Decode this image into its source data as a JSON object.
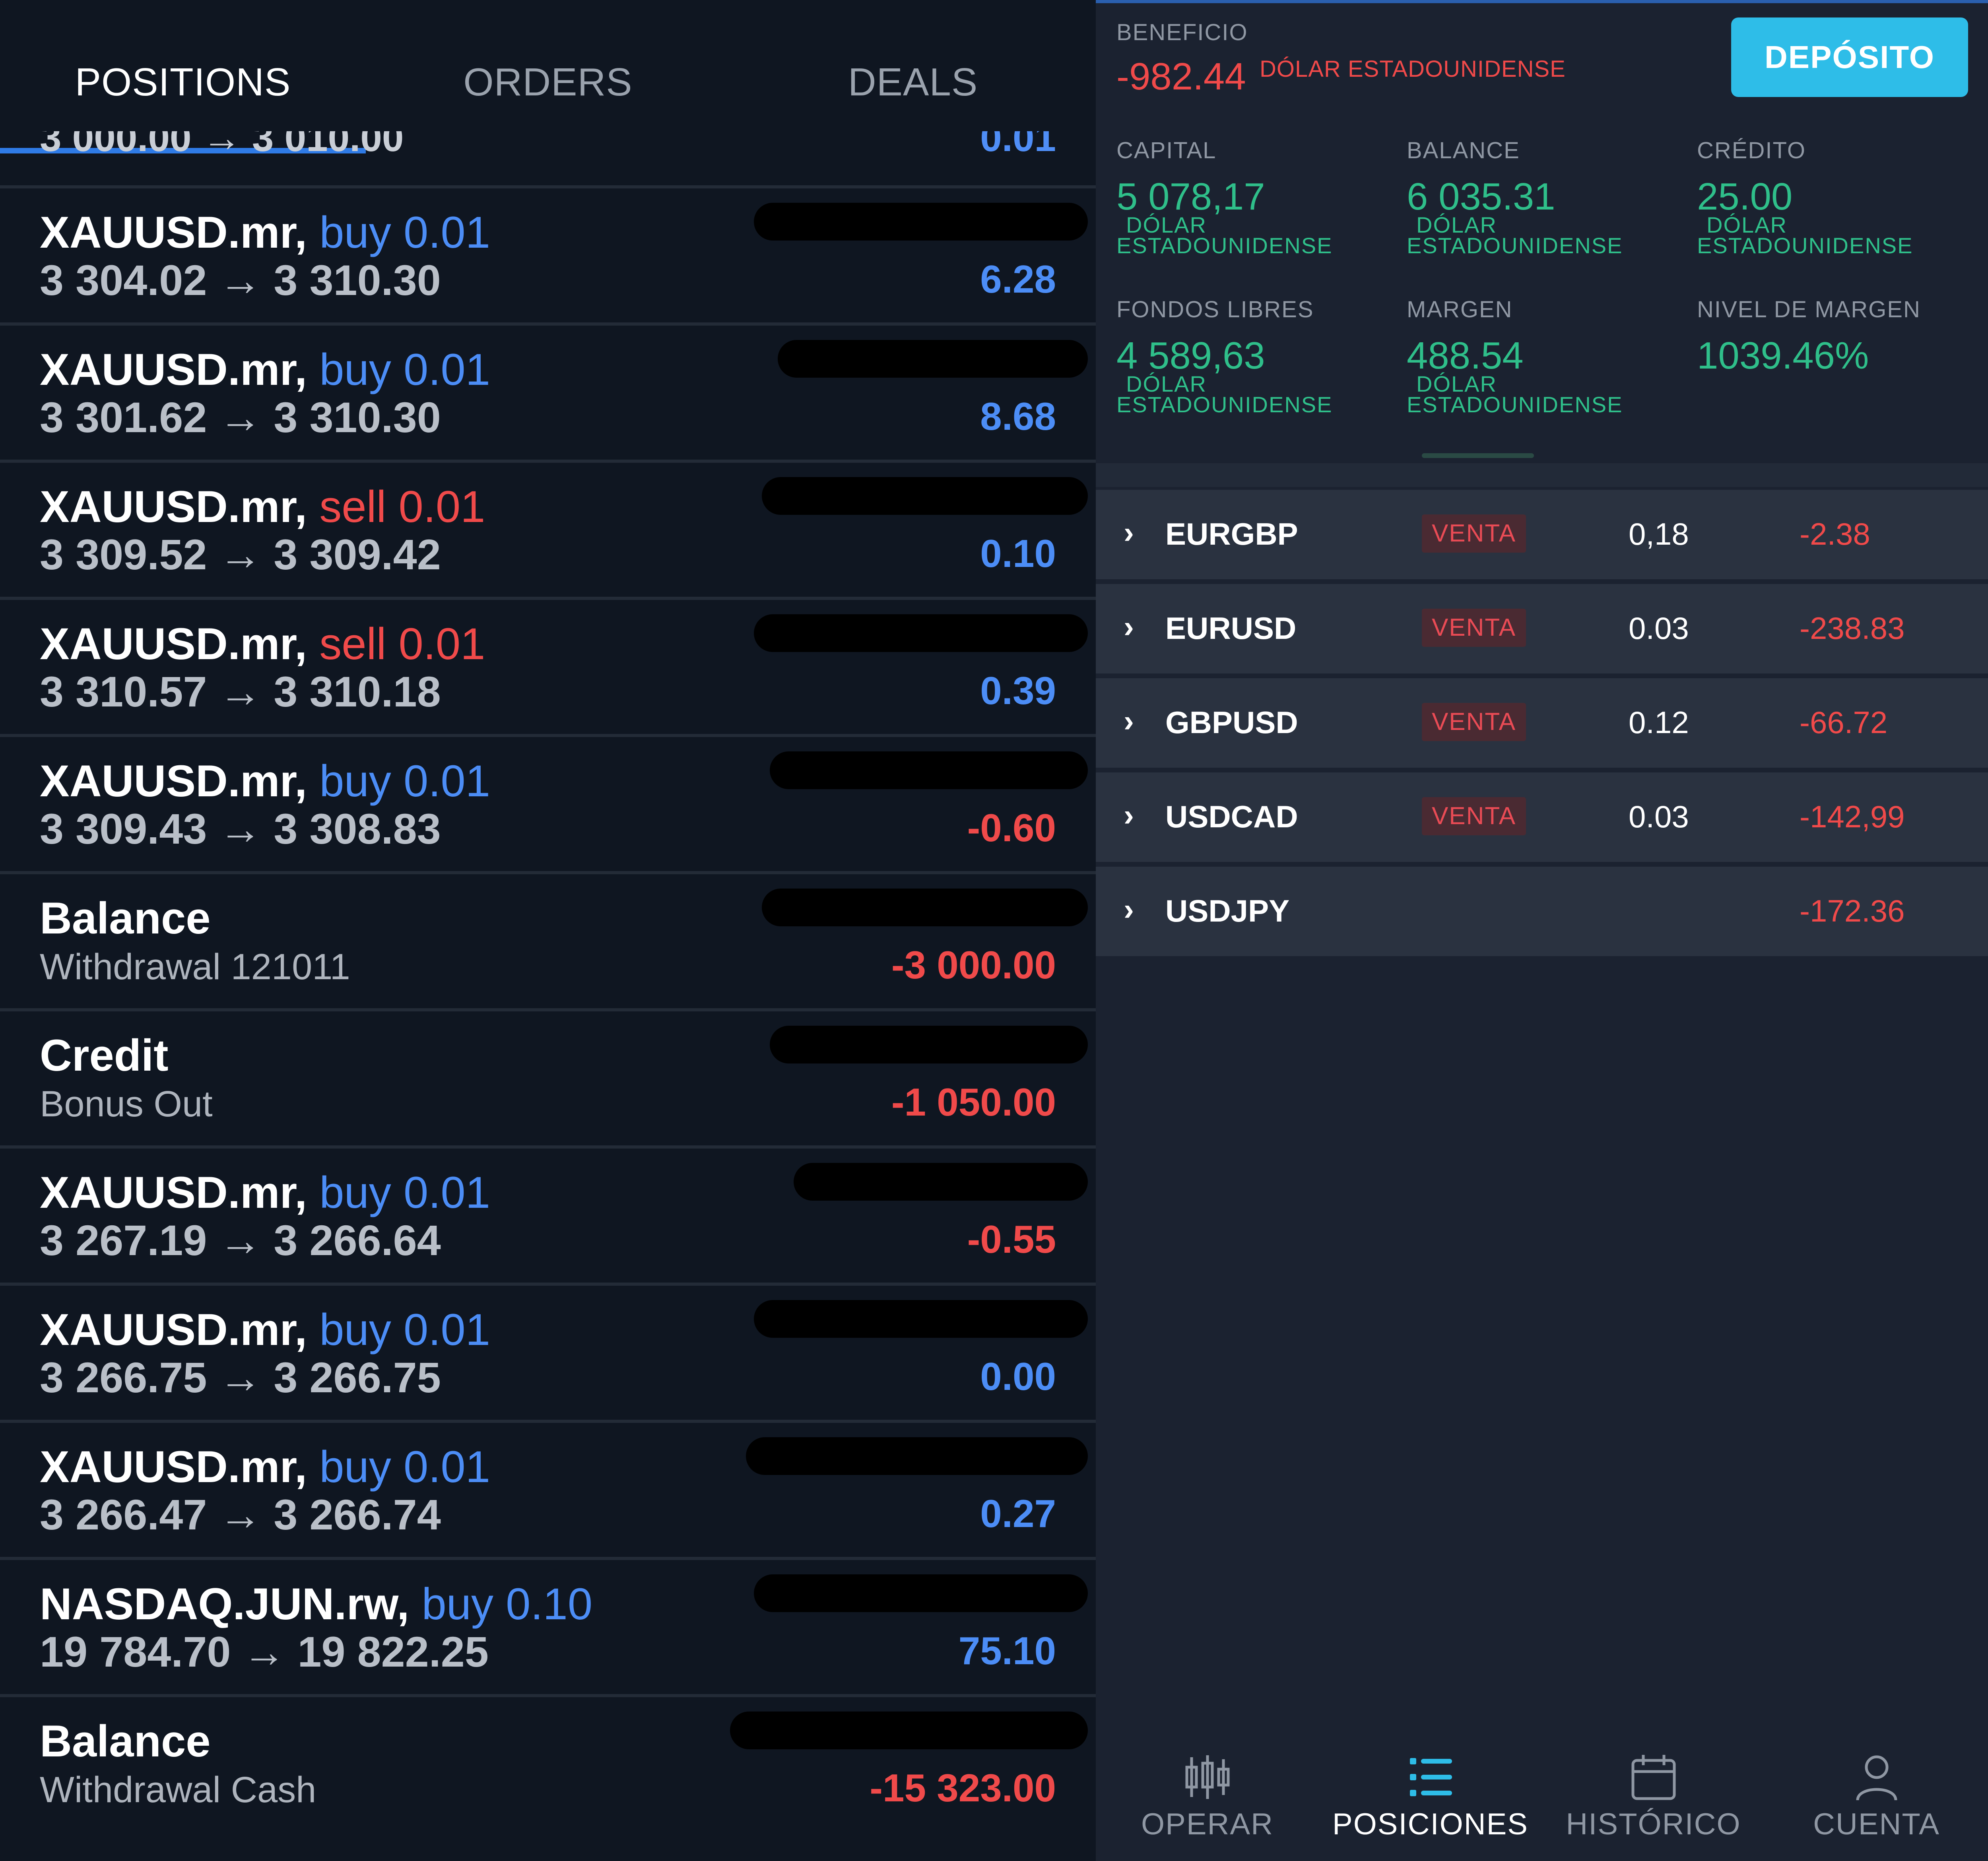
{
  "left": {
    "tabs": [
      {
        "label": "POSITIONS",
        "active": true
      },
      {
        "label": "ORDERS",
        "active": false
      },
      {
        "label": "DEALS",
        "active": false
      }
    ],
    "deals": [
      {
        "title": "XAUUSD.mr,",
        "side": "buy",
        "side_label": "buy 0.01",
        "prices": "3 304.02 → 3 310.30",
        "profit": "6.28",
        "sign": "pos"
      },
      {
        "title": "XAUUSD.mr,",
        "side": "buy",
        "side_label": "buy 0.01",
        "prices": "3 301.62 → 3 310.30",
        "profit": "8.68",
        "sign": "pos"
      },
      {
        "title": "XAUUSD.mr,",
        "side": "sell",
        "side_label": "sell 0.01",
        "prices": "3 309.52 → 3 309.42",
        "profit": "0.10",
        "sign": "pos"
      },
      {
        "title": "XAUUSD.mr,",
        "side": "sell",
        "side_label": "sell 0.01",
        "prices": "3 310.57 → 3 310.18",
        "profit": "0.39",
        "sign": "pos"
      },
      {
        "title": "XAUUSD.mr,",
        "side": "buy",
        "side_label": "buy 0.01",
        "prices": "3 309.43 → 3 308.83",
        "profit": "-0.60",
        "sign": "neg"
      },
      {
        "title": "Balance",
        "side": "",
        "side_label": "",
        "prices": "Withdrawal 121011",
        "profit": "-3 000.00",
        "sign": "neg",
        "plain": true
      },
      {
        "title": "Credit",
        "side": "",
        "side_label": "",
        "prices": "Bonus Out",
        "profit": "-1 050.00",
        "sign": "neg",
        "plain": true
      },
      {
        "title": "XAUUSD.mr,",
        "side": "buy",
        "side_label": "buy 0.01",
        "prices": "3 267.19 → 3 266.64",
        "profit": "-0.55",
        "sign": "neg"
      },
      {
        "title": "XAUUSD.mr,",
        "side": "buy",
        "side_label": "buy 0.01",
        "prices": "3 266.75 → 3 266.75",
        "profit": "0.00",
        "sign": "pos"
      },
      {
        "title": "XAUUSD.mr,",
        "side": "buy",
        "side_label": "buy 0.01",
        "prices": "3 266.47 → 3 266.74",
        "profit": "0.27",
        "sign": "pos"
      },
      {
        "title": "NASDAQ.JUN.rw,",
        "side": "buy",
        "side_label": "buy 0.10",
        "prices": "19 784.70 → 19 822.25",
        "profit": "75.10",
        "sign": "pos"
      },
      {
        "title": "Balance",
        "side": "",
        "side_label": "",
        "prices": "Withdrawal Cash",
        "profit": "-15 323.00",
        "sign": "neg",
        "plain": true
      }
    ]
  },
  "right": {
    "profit_label": "BENEFICIO",
    "profit_value": "-982.44",
    "profit_currency": "DÓLAR ESTADOUNIDENSE",
    "deposit_label": "DEPÓSITO",
    "unit_line1": "DÓLAR",
    "unit_line2": "ESTADOUNIDENSE",
    "stats": [
      {
        "label": "CAPITAL",
        "value": "5 078,17",
        "unit": true
      },
      {
        "label": "BALANCE",
        "value": "6 035.31",
        "unit": true
      },
      {
        "label": "CRÉDITO",
        "value": "25.00",
        "unit": true
      },
      {
        "label": "FONDOS LIBRES",
        "value": "4 589,63",
        "unit": true
      },
      {
        "label": "MARGEN",
        "value": "488.54",
        "unit": true
      },
      {
        "label": "NIVEL DE MARGEN",
        "value": "1039.46%",
        "unit": false
      }
    ],
    "positions": [
      {
        "symbol": "EURGBP",
        "side": "VENTA",
        "volume": "0,18",
        "pl": "-2.38"
      },
      {
        "symbol": "EURUSD",
        "side": "VENTA",
        "volume": "0.03",
        "pl": "-238.83"
      },
      {
        "symbol": "GBPUSD",
        "side": "VENTA",
        "volume": "0.12",
        "pl": "-66.72"
      },
      {
        "symbol": "USDCAD",
        "side": "VENTA",
        "volume": "0.03",
        "pl": "-142,99"
      },
      {
        "symbol": "USDJPY",
        "side": "",
        "volume": "",
        "pl": "-172.36"
      }
    ],
    "nav": [
      {
        "label": "OPERAR",
        "icon": "candlestick-icon",
        "active": false
      },
      {
        "label": "POSICIONES",
        "icon": "list-icon",
        "active": true
      },
      {
        "label": "HISTÓRICO",
        "icon": "calendar-icon",
        "active": false
      },
      {
        "label": "CUENTA",
        "icon": "user-icon",
        "active": false
      }
    ],
    "colors": {
      "profit": "#2fbf8a",
      "loss": "#f04a4a",
      "accent": "#2ebde8",
      "buy": "#4c8df6"
    }
  }
}
